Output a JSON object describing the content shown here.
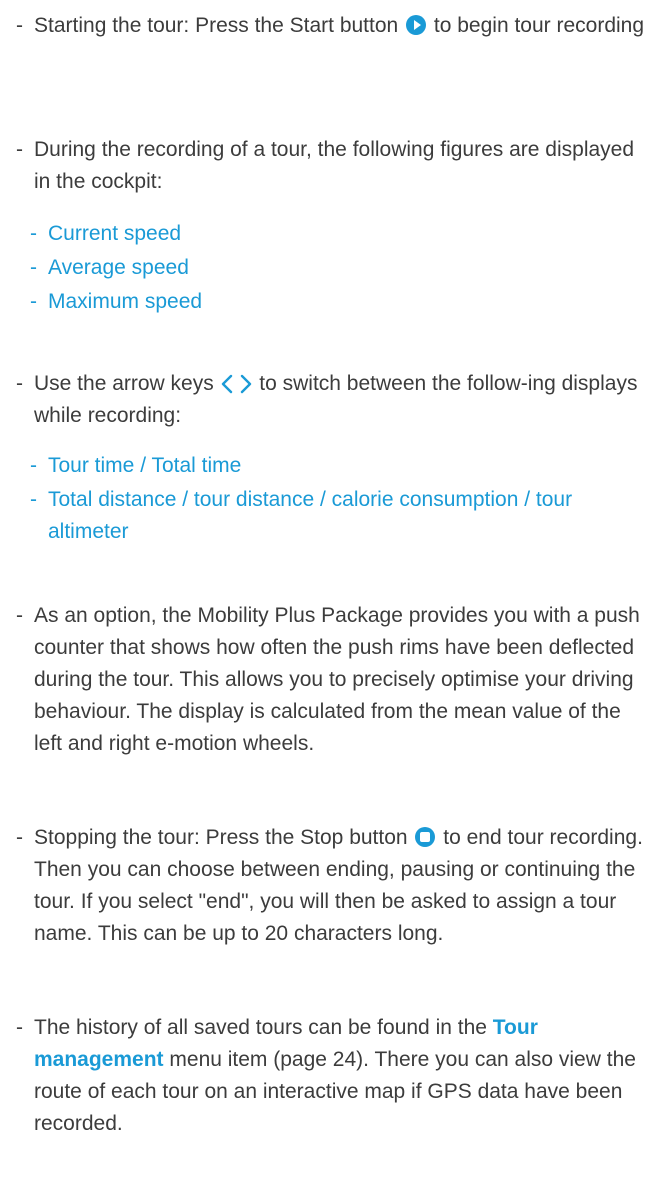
{
  "bullets": {
    "dash": "-",
    "start_pre": "Starting the tour: Press the Start button",
    "start_post": "to begin tour recording",
    "during": "During the recording of a tour, the following figures are displayed in the cockpit:",
    "figures": [
      "Current speed",
      "Average speed",
      "Maximum speed"
    ],
    "arrows_pre": "Use the arrow keys",
    "arrows_post": "to switch between the follow-ing displays while recording:",
    "displays": [
      "Tour time / Total time",
      "Total distance / tour distance / calorie consumption / tour altimeter"
    ],
    "push_counter": "As an option, the Mobility Plus Package provides you with a push counter that shows how often the push rims have been deflected during the tour. This allows you to precisely optimise your driving behaviour. The display is calculated from the mean value of the left and right e-motion wheels.",
    "stop_pre": "Stopping the tour: Press the Stop button",
    "stop_post": "to end tour recording. Then you can choose between ending, pausing or continuing the tour. If you select \"end\", you will then be asked to assign a tour name. This can be up to 20 characters long.",
    "history_pre": "The history of all saved tours can be found in the",
    "history_link": "Tour management",
    "history_post": "menu item (page 24). There you can also view the route of each tour on an interactive map if GPS data have been recorded."
  },
  "icons": {
    "start": "play-icon",
    "stop": "stop-icon",
    "left": "chevron-left-icon",
    "right": "chevron-right-icon"
  },
  "colors": {
    "text": "#3c3c3c",
    "accent": "#1a9ad6"
  }
}
